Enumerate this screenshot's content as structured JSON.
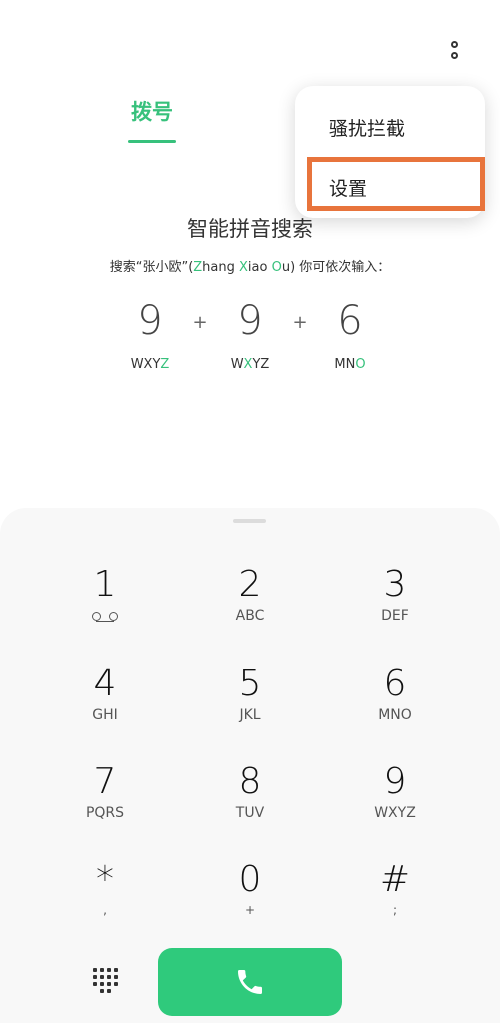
{
  "header": {
    "tab_label": "拨号",
    "more_icon": "more-vertical-icon"
  },
  "menu": {
    "items": [
      {
        "label": "骚扰拦截"
      },
      {
        "label": "设置"
      }
    ],
    "highlight_color": "#e8743c"
  },
  "hint": {
    "title": "智能拼音搜索",
    "sub_prefix": "搜索“张小欧”(",
    "z_letter": "Z",
    "hang": "hang ",
    "x_letter": "X",
    "iao": "iao ",
    "o_letter": "O",
    "sub_suffix": "u) 你可依次输入：",
    "example": [
      {
        "digit": "9",
        "letters_pre": "WXY",
        "letters_hl": "Z",
        "letters_post": ""
      },
      {
        "digit": "9",
        "letters_pre": "W",
        "letters_hl": "X",
        "letters_post": "YZ"
      },
      {
        "digit": "6",
        "letters_pre": "MN",
        "letters_hl": "O",
        "letters_post": ""
      }
    ],
    "plus": "+"
  },
  "keypad": {
    "keys": [
      {
        "num": "1",
        "sub": ""
      },
      {
        "num": "2",
        "sub": "ABC"
      },
      {
        "num": "3",
        "sub": "DEF"
      },
      {
        "num": "4",
        "sub": "GHI"
      },
      {
        "num": "5",
        "sub": "JKL"
      },
      {
        "num": "6",
        "sub": "MNO"
      },
      {
        "num": "7",
        "sub": "PQRS"
      },
      {
        "num": "8",
        "sub": "TUV"
      },
      {
        "num": "9",
        "sub": "WXYZ"
      },
      {
        "num": "*",
        "sub": ","
      },
      {
        "num": "0",
        "sub": "+"
      },
      {
        "num": "#",
        "sub": ";"
      }
    ]
  },
  "colors": {
    "accent": "#37c17c",
    "call_button": "#2fca7c"
  },
  "icons": {
    "voicemail": "voicemail-icon",
    "dialpad_toggle": "dialpad-grid-icon",
    "call": "phone-icon"
  }
}
